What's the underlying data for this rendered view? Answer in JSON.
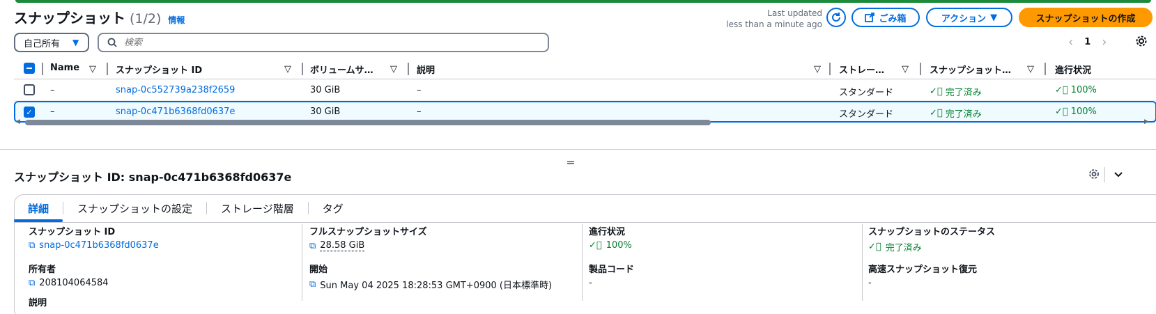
{
  "header": {
    "title": "スナップショット",
    "count": "(1/2)",
    "info": "情報",
    "last_updated_line1": "Last updated",
    "last_updated_line2": "less than a minute ago",
    "trash_label": "ごみ箱",
    "actions_label": "アクション",
    "create_label": "スナップショットの作成"
  },
  "filter": {
    "owner_value": "自己所有",
    "search_placeholder": "検索"
  },
  "pager": {
    "page": "1"
  },
  "table": {
    "columns": [
      "Name",
      "スナップショット ID",
      "ボリュームサ…",
      "説明",
      "ストレー…",
      "スナップショット…",
      "進行状況"
    ],
    "rows": [
      {
        "name": "–",
        "id": "snap-0c552739a238f2659",
        "size": "30 GiB",
        "desc": "–",
        "storage": "スタンダード",
        "status": "完了済み",
        "progress": "100%",
        "selected": false
      },
      {
        "name": "–",
        "id": "snap-0c471b6368fd0637e",
        "size": "30 GiB",
        "desc": "–",
        "storage": "スタンダード",
        "status": "完了済み",
        "progress": "100%",
        "selected": true
      }
    ]
  },
  "detail": {
    "title": "スナップショット ID: snap-0c471b6368fd0637e",
    "tabs": [
      "詳細",
      "スナップショットの設定",
      "ストレージ階層",
      "タグ"
    ],
    "fields": {
      "snapshot_id_label": "スナップショット ID",
      "snapshot_id_value": "snap-0c471b6368fd0637e",
      "owner_label": "所有者",
      "owner_value": "208104064584",
      "desc_label": "説明",
      "full_size_label": "フルスナップショットサイズ",
      "full_size_value": "28.58 GiB",
      "start_label": "開始",
      "start_value": "Sun May 04 2025 18:28:53 GMT+0900 (日本標準時)",
      "progress_label": "進行状況",
      "progress_value": "100%",
      "product_code_label": "製品コード",
      "product_code_value": "-",
      "status_label": "スナップショットのステータス",
      "status_value": "完了済み",
      "fast_restore_label": "高速スナップショット復元",
      "fast_restore_value": "-"
    }
  },
  "colors": {
    "accent": "#006ce0",
    "primary_button": "#ff9900",
    "success": "#00802f"
  }
}
